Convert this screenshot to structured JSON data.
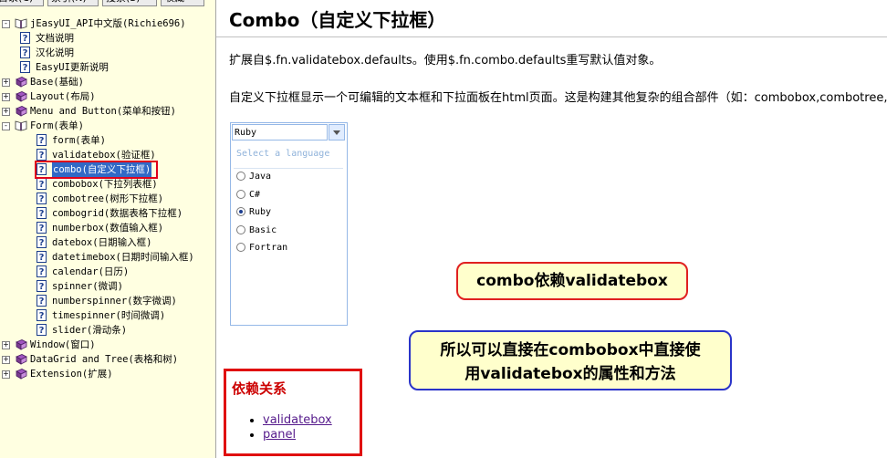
{
  "left_pane": {
    "tabs": [
      "目录(C)",
      "索引(N)",
      "搜索(S)",
      "收藏"
    ],
    "tree": [
      {
        "label": "jEasyUI_API中文版(Richie696)",
        "level": 0,
        "expander": "-",
        "icon": "book-open-icon"
      },
      {
        "label": "文档说明",
        "level": 1,
        "expander": "",
        "icon": "question-page-icon"
      },
      {
        "label": "汉化说明",
        "level": 1,
        "expander": "",
        "icon": "question-page-icon"
      },
      {
        "label": "EasyUI更新说明",
        "level": 1,
        "expander": "",
        "icon": "question-page-icon"
      },
      {
        "label": "Base(基础)",
        "level": 0,
        "expander": "+",
        "icon": "book-closed-icon"
      },
      {
        "label": "Layout(布局)",
        "level": 0,
        "expander": "+",
        "icon": "book-closed-icon"
      },
      {
        "label": "Menu and Button(菜单和按钮)",
        "level": 0,
        "expander": "+",
        "icon": "book-closed-icon"
      },
      {
        "label": "Form(表单)",
        "level": 0,
        "expander": "-",
        "icon": "book-open-icon"
      },
      {
        "label": "form(表单)",
        "level": 2,
        "expander": "",
        "icon": "question-page-icon"
      },
      {
        "label": "validatebox(验证框)",
        "level": 2,
        "expander": "",
        "icon": "question-page-icon"
      },
      {
        "label": "combo(自定义下拉框)",
        "level": 2,
        "expander": "",
        "icon": "question-page-icon",
        "selected": true
      },
      {
        "label": "combobox(下拉列表框)",
        "level": 2,
        "expander": "",
        "icon": "question-page-icon"
      },
      {
        "label": "combotree(树形下拉框)",
        "level": 2,
        "expander": "",
        "icon": "question-page-icon"
      },
      {
        "label": "combogrid(数据表格下拉框)",
        "level": 2,
        "expander": "",
        "icon": "question-page-icon"
      },
      {
        "label": "numberbox(数值输入框)",
        "level": 2,
        "expander": "",
        "icon": "question-page-icon"
      },
      {
        "label": "datebox(日期输入框)",
        "level": 2,
        "expander": "",
        "icon": "question-page-icon"
      },
      {
        "label": "datetimebox(日期时间输入框)",
        "level": 2,
        "expander": "",
        "icon": "question-page-icon"
      },
      {
        "label": "calendar(日历)",
        "level": 2,
        "expander": "",
        "icon": "question-page-icon"
      },
      {
        "label": "spinner(微调)",
        "level": 2,
        "expander": "",
        "icon": "question-page-icon"
      },
      {
        "label": "numberspinner(数字微调)",
        "level": 2,
        "expander": "",
        "icon": "question-page-icon"
      },
      {
        "label": "timespinner(时间微调)",
        "level": 2,
        "expander": "",
        "icon": "question-page-icon"
      },
      {
        "label": "slider(滑动条)",
        "level": 2,
        "expander": "",
        "icon": "question-page-icon"
      },
      {
        "label": "Window(窗口)",
        "level": 0,
        "expander": "+",
        "icon": "book-closed-icon"
      },
      {
        "label": "DataGrid and Tree(表格和树)",
        "level": 0,
        "expander": "+",
        "icon": "book-closed-icon"
      },
      {
        "label": "Extension(扩展)",
        "level": 0,
        "expander": "+",
        "icon": "book-closed-icon"
      }
    ]
  },
  "content": {
    "title": "Combo（自定义下拉框）",
    "para1": "扩展自$.fn.validatebox.defaults。使用$.fn.combo.defaults重写默认值对象。",
    "para2": "自定义下拉框显示一个可编辑的文本框和下拉面板在html页面。这是构建其他复杂的组合部件（如：combobox,combotree,combogrid等）",
    "combo": {
      "value": "Ruby",
      "hint": "Select a language",
      "options": [
        {
          "label": "Java",
          "checked": false
        },
        {
          "label": "C#",
          "checked": false
        },
        {
          "label": "Ruby",
          "checked": true
        },
        {
          "label": "Basic",
          "checked": false
        },
        {
          "label": "Fortran",
          "checked": false
        }
      ]
    },
    "callout1": "combo依赖validatebox",
    "callout2_line1": "所以可以直接在combobox中直接使",
    "callout2_line2": "用validatebox的属性和方法",
    "deps_title": "依赖关系",
    "deps": [
      "validatebox",
      "panel"
    ]
  }
}
